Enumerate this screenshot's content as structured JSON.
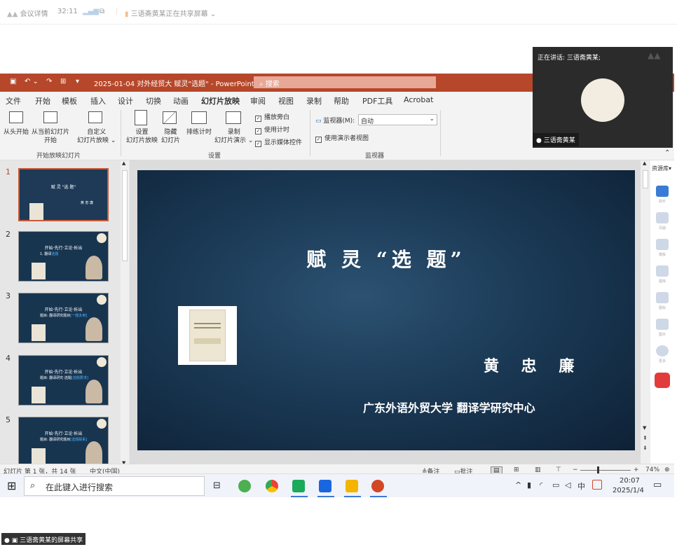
{
  "meeting": {
    "details": "会议详情",
    "timer": "32:11",
    "share_status": "三语斋黄某正在共享屏幕"
  },
  "ppt": {
    "doc_title": "2025-01-04  对外经贸大  赋灵\"选题\"  -  PowerPoint",
    "search_placeholder": "搜索",
    "tabs": [
      "文件",
      "开始",
      "模板",
      "插入",
      "设计",
      "切换",
      "动画",
      "幻灯片放映",
      "审阅",
      "视图",
      "录制",
      "帮助",
      "PDF工具",
      "Acrobat"
    ],
    "ribbon": {
      "from_start": "从头开始",
      "from_current_1": "从当前幻灯片",
      "from_current_2": "开始",
      "custom_1": "自定义",
      "custom_2": "幻灯片放映",
      "group_start": "开始放映幻灯片",
      "setup_1": "设置",
      "setup_2": "幻灯片放映",
      "hide_1": "隐藏",
      "hide_2": "幻灯片",
      "rehearse": "排练计时",
      "record_1": "录制",
      "record_2": "幻灯片演示",
      "play_narration": "播放旁白",
      "use_timings": "使用计时",
      "show_media": "显示媒体控件",
      "group_setup": "设置",
      "monitor_label": "监视器(M):",
      "monitor_value": "自动",
      "presenter_view": "使用演示者视图",
      "group_monitor": "监视器"
    },
    "thumbnails": [
      {
        "num": "1",
        "title": "赋 灵 \"选 题\"",
        "sub": "黄 忠 廉"
      },
      {
        "num": "2",
        "title": "开始·先行·立论·析出",
        "sub": "1. 翻译",
        "sub_hl": "选题"
      },
      {
        "num": "3",
        "title": "开始·先行·立论·析出",
        "sub": "题目: 翻译研究题目",
        "sub_hl": "[一题多用]"
      },
      {
        "num": "4",
        "title": "开始·先行·立论·析出",
        "sub": "题目: 翻译研究·选题",
        "sub_hl": "[选题要求]"
      },
      {
        "num": "5",
        "title": "开始·先行·立论·析出",
        "sub": "题目: 翻译研究题目",
        "sub_hl": "[选题联系]"
      }
    ],
    "slide": {
      "title": "赋 灵 “选 题”",
      "author": "黄 忠 廉",
      "org": "广东外语外贸大学  翻译学研究中心"
    },
    "sidebar": {
      "title": "资源库",
      "items": [
        "助手",
        "页面",
        "模板",
        "图库",
        "图标",
        "图示",
        "更多"
      ]
    },
    "status": {
      "slide_info": "幻灯片 第 1 张，共 14 张",
      "language": "中文(中国)",
      "notes": "备注",
      "comments": "批注",
      "zoom": "74%",
      "minus": "−",
      "plus": "+"
    }
  },
  "taskbar": {
    "search_placeholder": "在此键入进行搜索",
    "time": "20:07",
    "date": "2025/1/4",
    "ime": "中"
  },
  "video": {
    "speaking": "正在讲话:  三语斋黄某;",
    "name": "三语斋黄某"
  },
  "screen_share_label": "三语斋黄某的屏幕共享",
  "colors": {
    "ppt_accent": "#b7472a",
    "slide_bg": "#1b3a56"
  }
}
